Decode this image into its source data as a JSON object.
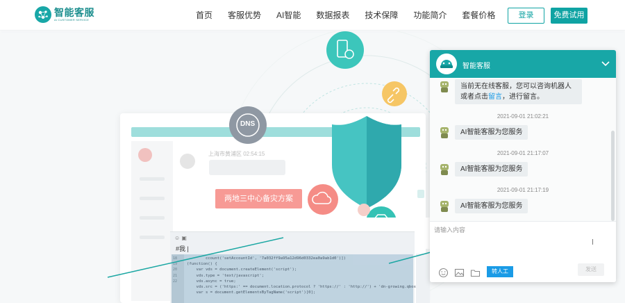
{
  "brand": {
    "title": "智能客服",
    "subtitle": "AI CUSTOMER SERVICE"
  },
  "nav": {
    "items": [
      "首页",
      "客服优势",
      "AI智能",
      "数据报表",
      "技术保障",
      "功能简介",
      "套餐价格"
    ]
  },
  "header_buttons": {
    "login": "登录",
    "trial": "免费试用"
  },
  "hero": {
    "dns_label": "DNS",
    "plan_label": "两地三中心备灾方案",
    "location_text": "上海市黄浦区 02:54:15",
    "code": {
      "hash_line": "#我 |",
      "lines": [
        "        ccount('setAccountId', '7a032ff9a95a12d96d0332ea0a9ab1d0')])",
        "(function() {",
        "    var vds = document.createElement('script');",
        "    vds.type = 'text/javascript';",
        "    vds.async = true;",
        "    vds.src = ('https:' == document.location.protocol ? 'https://' : 'http://') + 'dn-growing.qbox.m",
        "    var s = document.getElementsByTagName('script')[0];"
      ],
      "line_numbers": [
        "",
        "",
        "18",
        "19",
        "20",
        "21",
        "22"
      ]
    }
  },
  "chat": {
    "title": "智能客服",
    "offline_message_before": "当前无在线客服，您可以咨询机器人或者点击",
    "offline_message_link": "留言",
    "offline_message_after": "，进行留言。",
    "messages": [
      {
        "time": "2021-09-01 21:02:21",
        "text": "AI智能客服为您服务"
      },
      {
        "time": "2021-09-01 21:17:07",
        "text": "AI智能客服为您服务"
      },
      {
        "time": "2021-09-01 21:17:19",
        "text": "AI智能客服为您服务"
      }
    ],
    "input_placeholder": "请输入内容",
    "transfer_label": "转人工",
    "send_label": "发送"
  },
  "colors": {
    "brand_teal": "#18a7a7",
    "accent_blue": "#1a9be6",
    "pill_pink": "#f79a95",
    "shield": "#3fc0bf"
  },
  "icons": [
    "emoji-icon",
    "image-icon",
    "folder-icon",
    "robot-icon",
    "chevron-down-icon",
    "shield-icon",
    "dns-icon",
    "link-icon",
    "cloud-sync-icon",
    "diamond-icon",
    "mobile-chart-icon"
  ]
}
